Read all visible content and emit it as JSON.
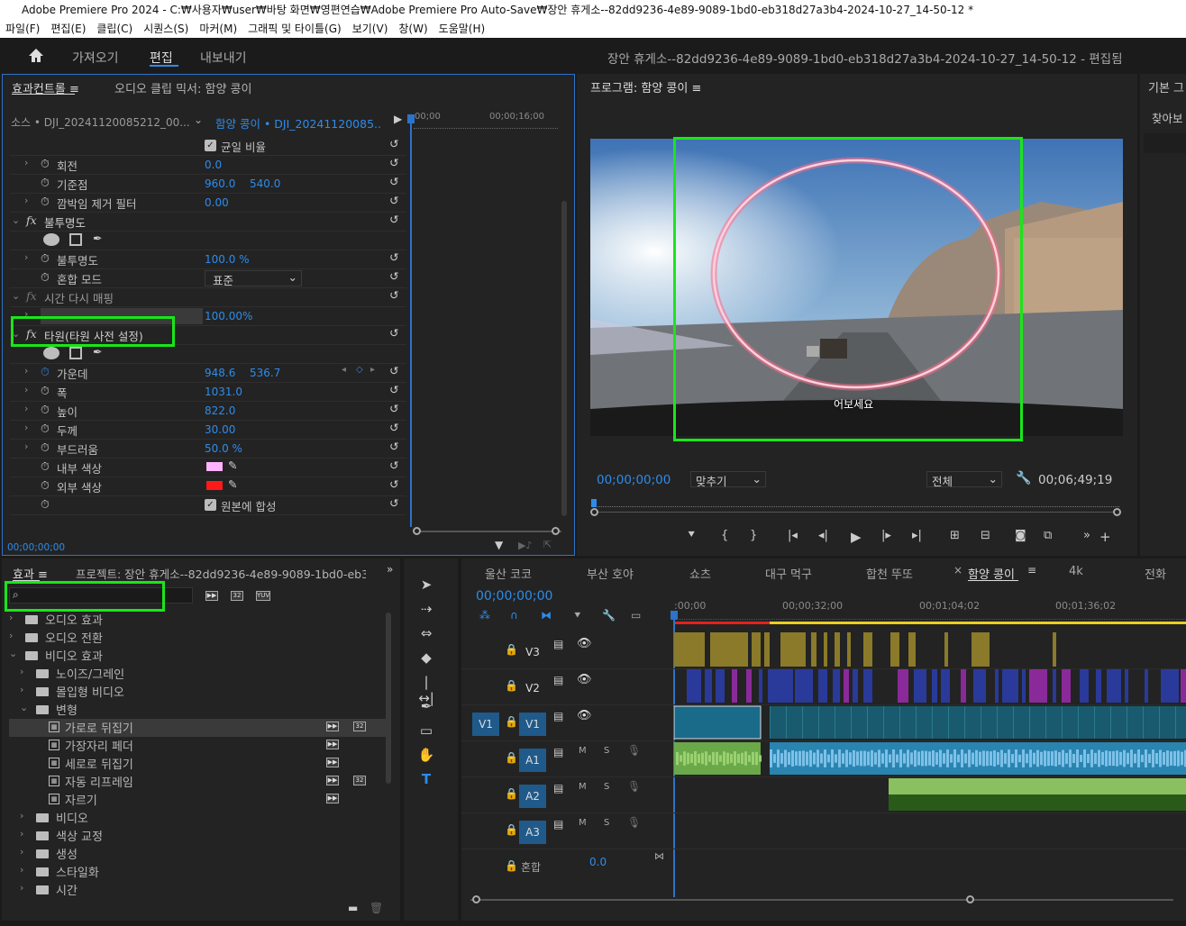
{
  "window": {
    "title": "Adobe Premiere Pro 2024 - C:₩사용자₩user₩바탕 화면₩영편연습₩Adobe Premiere Pro Auto-Save₩장안 휴게소--82dd9236-4e89-9089-1bd0-eb318d27a3b4-2024-10-27_14-50-12 *",
    "logo": "Pr"
  },
  "menu": [
    "파일(F)",
    "편집(E)",
    "클립(C)",
    "시퀀스(S)",
    "마커(M)",
    "그래픽 및 타이틀(G)",
    "보기(V)",
    "창(W)",
    "도움말(H)"
  ],
  "workspace": {
    "tabs": [
      "가져오기",
      "편집",
      "내보내기"
    ],
    "active": "편집",
    "project_title": "장안 휴게소--82dd9236-4e89-9089-1bd0-eb318d27a3b4-2024-10-27_14-50-12 - 편집됨"
  },
  "effect_controls": {
    "tab": "효과컨트롤",
    "tab2": "오디오 클립 믹서: 함양 콩이",
    "source": "소스 • DJI_20241120085212_00...",
    "clip": "함양 콩이 • DJI_20241120085...",
    "tc_start": "00;00",
    "tc_mid": "00;00;16;00",
    "timecode": "00;00;00;00",
    "rows": [
      {
        "label": "균일 비율",
        "type": "check"
      },
      {
        "label": "회전",
        "v1": "0.0"
      },
      {
        "label": "기준점",
        "v1": "960.0",
        "v2": "540.0"
      },
      {
        "label": "깜박임 제거 필터",
        "v1": "0.00"
      },
      {
        "label": "불투명도",
        "type": "fx"
      },
      {
        "label": "",
        "type": "masks"
      },
      {
        "label": "불투명도",
        "v1": "100.0 %"
      },
      {
        "label": "혼합 모드",
        "select": "표준"
      },
      {
        "label": "시간 다시 매핑",
        "type": "fx"
      },
      {
        "label": "속도",
        "v1": "100.00%"
      },
      {
        "label": "타원(타원 사전 설정)",
        "type": "fx"
      },
      {
        "label": "",
        "type": "masks"
      },
      {
        "label": "가운데",
        "v1": "948.6",
        "v2": "536.7"
      },
      {
        "label": "폭",
        "v1": "1031.0"
      },
      {
        "label": "높이",
        "v1": "822.0"
      },
      {
        "label": "두께",
        "v1": "30.00"
      },
      {
        "label": "부드러움",
        "v1": "50.0 %"
      },
      {
        "label": "내부 색상",
        "color": "#ffb3ff"
      },
      {
        "label": "외부 색상",
        "color": "#ff1a1a"
      },
      {
        "label": "원본에 합성",
        "type": "check2"
      }
    ]
  },
  "program": {
    "title": "프로그램: 함양 콩이",
    "timecode": "00;00;00;00",
    "fit": "맞추기",
    "quality": "전체",
    "duration": "00;06;49;19",
    "subtitle": "어보세요"
  },
  "right_panel": {
    "tab": "기본 그",
    "find": "찾아보"
  },
  "effects_panel": {
    "tab": "효과",
    "tab2": "프로젝트: 장안 휴게소--82dd9236-4e89-9089-1bd0-eb31",
    "search_value": "",
    "badges": [
      "32",
      "YUV"
    ],
    "items": [
      {
        "label": "오디오 효과",
        "level": 0,
        "kind": "folder",
        "open": false
      },
      {
        "label": "오디오 전환",
        "level": 0,
        "kind": "folder",
        "open": false
      },
      {
        "label": "비디오 효과",
        "level": 0,
        "kind": "folder",
        "open": true
      },
      {
        "label": "노이즈/그레인",
        "level": 1,
        "kind": "folder",
        "open": false
      },
      {
        "label": "몰입형 비디오",
        "level": 1,
        "kind": "folder",
        "open": false
      },
      {
        "label": "변형",
        "level": 1,
        "kind": "folder",
        "open": true
      },
      {
        "label": "가로로 뒤집기",
        "level": 2,
        "kind": "effect",
        "selected": true
      },
      {
        "label": "가장자리 페더",
        "level": 2,
        "kind": "effect"
      },
      {
        "label": "세로로 뒤집기",
        "level": 2,
        "kind": "effect"
      },
      {
        "label": "자동 리프레임",
        "level": 2,
        "kind": "effect"
      },
      {
        "label": "자르기",
        "level": 2,
        "kind": "effect"
      },
      {
        "label": "비디오",
        "level": 1,
        "kind": "folder",
        "open": false
      },
      {
        "label": "색상 교정",
        "level": 1,
        "kind": "folder",
        "open": false
      },
      {
        "label": "생성",
        "level": 1,
        "kind": "folder",
        "open": false
      },
      {
        "label": "스타일화",
        "level": 1,
        "kind": "folder",
        "open": false
      },
      {
        "label": "시간",
        "level": 1,
        "kind": "folder",
        "open": false
      }
    ]
  },
  "timeline": {
    "tabs": [
      "울산 코코",
      "부산 호야",
      "쇼츠",
      "대구 먹구",
      "합천 뚜또",
      "함양 콩이",
      "4k",
      "전화"
    ],
    "active_tab": "함양 콩이",
    "timecode": "00;00;00;00",
    "ruler": [
      ":00;00",
      "00;00;32;00",
      "00;01;04;02",
      "00;01;36;02"
    ],
    "tracks": [
      {
        "name": "V3",
        "kind": "video"
      },
      {
        "name": "V2",
        "kind": "video"
      },
      {
        "name": "V1",
        "kind": "video",
        "src": "V1"
      },
      {
        "name": "A1",
        "kind": "audio"
      },
      {
        "name": "A2",
        "kind": "audio"
      },
      {
        "name": "A3",
        "kind": "audio"
      }
    ],
    "mix_label": "혼합",
    "mix_value": "0.0",
    "m": "M",
    "s": "S"
  },
  "colors": {
    "accent": "#2d8ceb",
    "highlight": "#19e619",
    "ellipse": "#ff3b6b"
  }
}
